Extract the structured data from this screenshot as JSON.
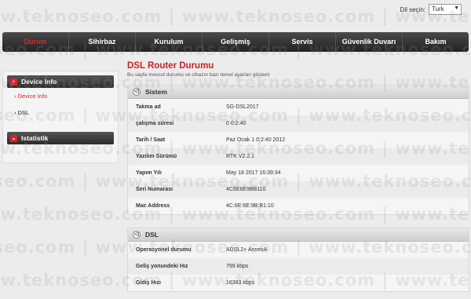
{
  "language": {
    "label": "Dil seçin:",
    "selected": "Turk"
  },
  "nav": [
    "Durum",
    "Sihirbaz",
    "Kurulum",
    "Gelişmiş",
    "Servis",
    "Güvenlik Duvarı",
    "Bakım"
  ],
  "sidebar": {
    "section1": "Device Info",
    "link1": "Device Info",
    "link2": "DSL",
    "section2": "Istatistik"
  },
  "page": {
    "title": "DSL Router Durumu",
    "subtitle": "Bu sayfa mevcut durumu ve cihazın bazı temel ayarları gösterir"
  },
  "system": {
    "header": "Sistem",
    "rows": [
      {
        "label": "Takma ad",
        "value": "SG-DSL2017"
      },
      {
        "label": "çalışma süresi",
        "value": "0 0:2:40"
      },
      {
        "label": "Tarih / Saat",
        "value": "Paz Ocak 1 0:2:40 2012"
      },
      {
        "label": "Yazılım Sürümü",
        "value": "RTK V2.2.1"
      },
      {
        "label": "Yapım Yılı",
        "value": "May 18 2017 16:39:34"
      },
      {
        "label": "Seri Numarası",
        "value": "4C6E6E9BB110"
      },
      {
        "label": "Mac Address",
        "value": "4C:6E:6E:9B:B1:10"
      }
    ]
  },
  "dsl": {
    "header": "DSL",
    "rows": [
      {
        "label": "Operasyonel durumu",
        "value": "ADSL2+ AnnexA"
      },
      {
        "label": "Geliş yonundeki Hız",
        "value": "799 kbps"
      },
      {
        "label": "Gidiş Hızı",
        "value": "16383 kbps"
      }
    ]
  },
  "watermark": "www.teknoseo.com  |  www.teknoseo.com  |  www.teknoseo.com"
}
